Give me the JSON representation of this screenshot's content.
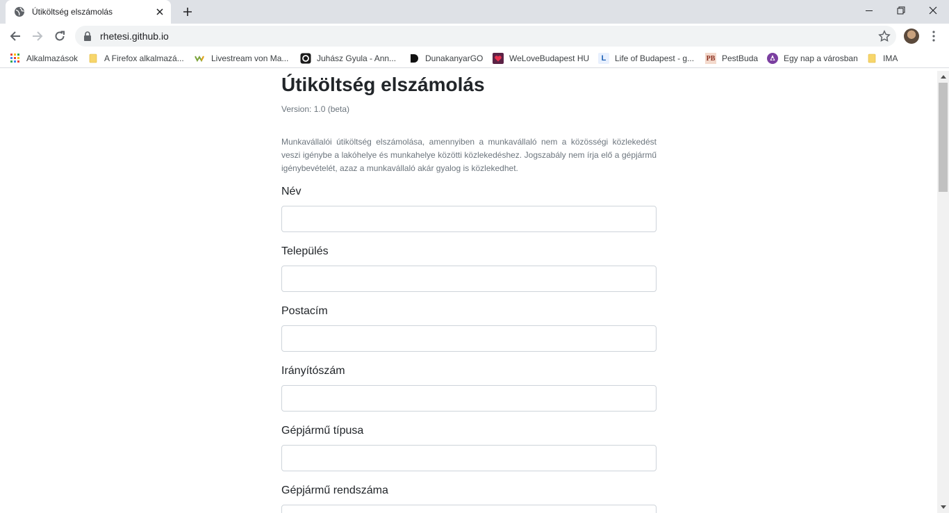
{
  "browser": {
    "tab_title": "Útiköltség elszámolás",
    "url": "rhetesi.github.io",
    "bookmarks": [
      {
        "label": "Alkalmazások",
        "icon": "apps-grid-icon"
      },
      {
        "label": "A Firefox alkalmazá...",
        "icon": "folder-icon"
      },
      {
        "label": "Livestream von Ma...",
        "icon": "livestream-icon"
      },
      {
        "label": "Juhász Gyula - Ann...",
        "icon": "instagram-icon"
      },
      {
        "label": "DunakanyarGO",
        "icon": "dunakanyargo-icon"
      },
      {
        "label": "WeLoveBudapest HU",
        "icon": "welovebudapest-icon"
      },
      {
        "label": "Life of Budapest - g...",
        "icon": "life-of-budapest-icon"
      },
      {
        "label": "PestBuda",
        "icon": "pestbuda-icon"
      },
      {
        "label": "Egy nap a városban",
        "icon": "egy-nap-icon"
      },
      {
        "label": "IMA",
        "icon": "folder-icon"
      }
    ],
    "bookmark_glyphs": {
      "pestbuda": "PB",
      "life": "L"
    }
  },
  "page": {
    "title": "Útiköltség elszámolás",
    "version": "Version: 1.0 (beta)",
    "description": "Munkavállalói útiköltség elszámolása, amennyiben a munkavállaló nem a közösségi közlekedést veszi igénybe a lakóhelye és munkahelye közötti közlekedéshez. Jogszabály nem írja elő a gépjármű igénybevételét, azaz a munkavállaló akár gyalog is közlekedhet.",
    "fields": [
      {
        "label": "Név",
        "value": ""
      },
      {
        "label": "Település",
        "value": ""
      },
      {
        "label": "Postacím",
        "value": ""
      },
      {
        "label": "Irányítószám",
        "value": ""
      },
      {
        "label": "Gépjármű típusa",
        "value": ""
      },
      {
        "label": "Gépjármű rendszáma",
        "value": ""
      }
    ]
  },
  "colors": {
    "tabstrip": "#dee1e6",
    "omnibox": "#f1f3f4",
    "text": "#212529",
    "muted": "#6c757d",
    "input_border": "#ced4da"
  }
}
